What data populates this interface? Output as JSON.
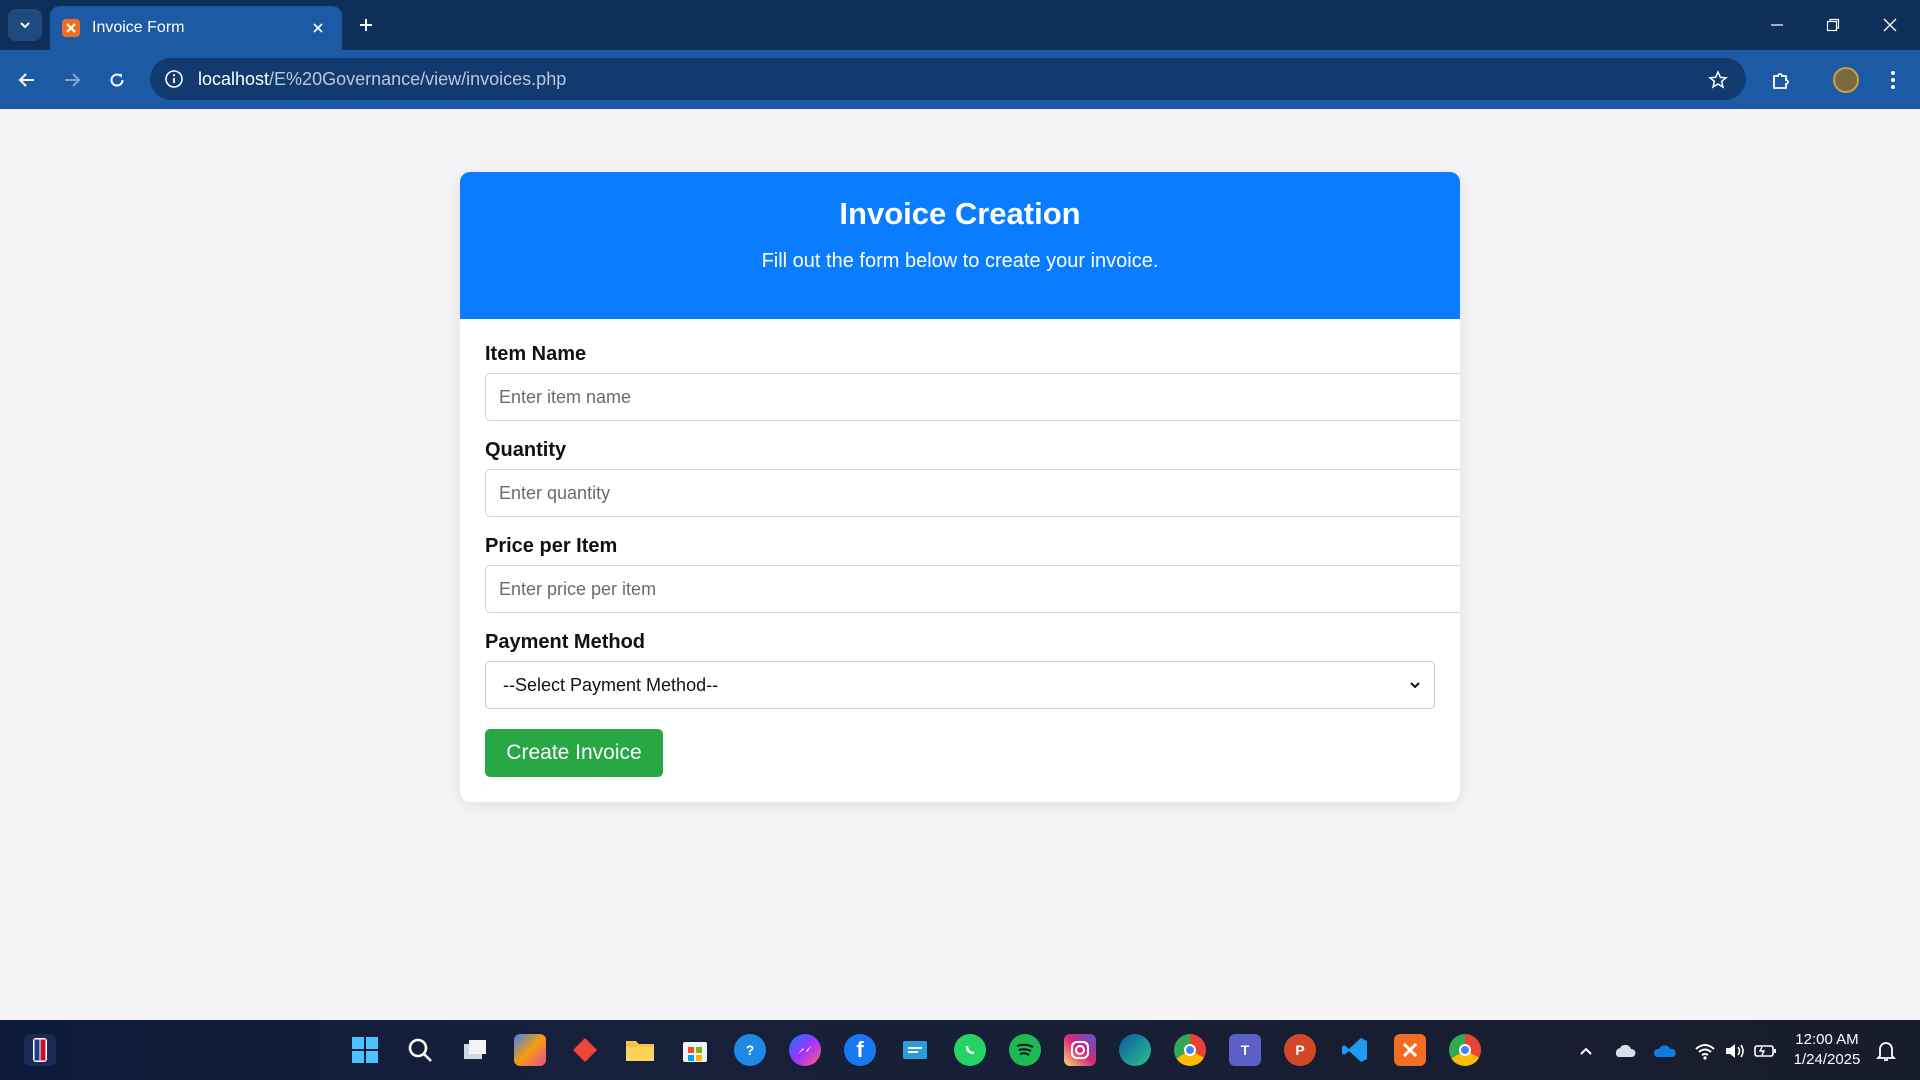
{
  "browser": {
    "tab_title": "Invoice Form",
    "url_host": "localhost",
    "url_path": "/E%20Governance/view/invoices.php"
  },
  "page": {
    "header_title": "Invoice Creation",
    "header_subtitle": "Fill out the form below to create your invoice.",
    "fields": [
      {
        "label": "Item Name",
        "placeholder": "Enter item name"
      },
      {
        "label": "Quantity",
        "placeholder": "Enter quantity"
      },
      {
        "label": "Price per Item",
        "placeholder": "Enter price per item"
      }
    ],
    "payment": {
      "label": "Payment Method",
      "selected": "--Select Payment Method--"
    },
    "submit_label": "Create Invoice"
  },
  "taskbar": {
    "time": "12:00 AM",
    "date": "1/24/2025",
    "apps": [
      "windows-start",
      "search",
      "task-view",
      "copilot",
      "anydesk",
      "file-explorer",
      "microsoft-store",
      "help",
      "messenger",
      "facebook",
      "remote-desktop",
      "whatsapp",
      "spotify",
      "instagram",
      "edge",
      "chrome",
      "teams",
      "powerpoint",
      "vscode",
      "xampp",
      "chrome-profile"
    ]
  },
  "colors": {
    "header_blue": "#0a7cff",
    "button_green": "#28a745",
    "chrome_dark": "#0e2f5a",
    "chrome_toolbar": "#1d5aa6"
  }
}
